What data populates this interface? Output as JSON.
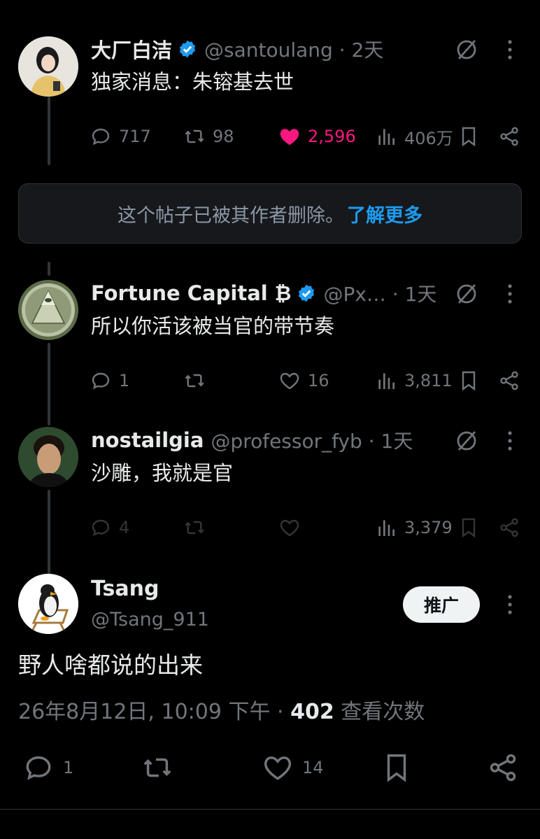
{
  "tweets": [
    {
      "name": "大厂白洁",
      "handle": "@santoulang · 2天",
      "text": "独家消息：朱镕基去世",
      "replies": "717",
      "retweets": "98",
      "likes": "2,596",
      "views": "406万",
      "liked": true
    },
    {
      "name": "Fortune Capital ₿",
      "handle": "@Px… · 1天",
      "text": "所以你活该被当官的带节奏",
      "replies": "1",
      "retweets": "",
      "likes": "16",
      "views": "3,811"
    },
    {
      "name": "nostailgia",
      "handle": "@professor_fyb · 1天",
      "text": "沙雕，我就是官",
      "replies": "4",
      "retweets": "",
      "likes": "",
      "views": "3,379"
    }
  ],
  "deleted_notice": {
    "text": "这个帖子已被其作者删除。",
    "link": "了解更多"
  },
  "main_tweet": {
    "name": "Tsang",
    "handle": "@Tsang_911",
    "promo_label": "推广",
    "text": "野人啥都说的出来",
    "date": "26年8月12日, 10:09 下午 · ",
    "views_count": "402",
    "views_label": " 查看次数",
    "replies": "1",
    "likes": "14"
  },
  "colors": {
    "background": "#000000",
    "accent": "#1d9bf0",
    "like": "#f91880",
    "muted": "#71767b"
  }
}
